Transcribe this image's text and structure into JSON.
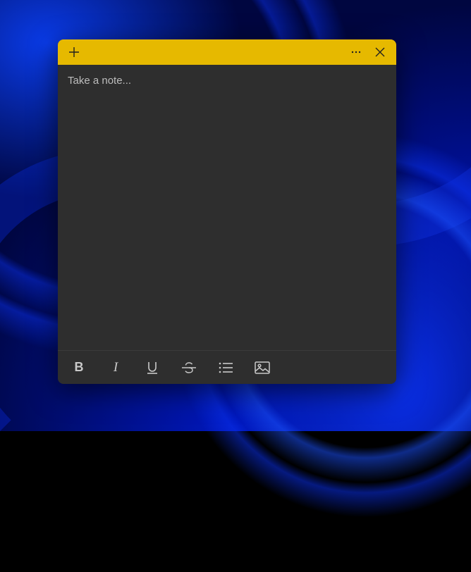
{
  "colors": {
    "titlebar": "#e6b900",
    "window_bg": "#2e2e2e",
    "placeholder": "#bdbdbd",
    "icon": "#c9c9c9"
  },
  "note": {
    "placeholder": "Take a note...",
    "content": ""
  },
  "titlebar": {
    "add_icon": "plus-icon",
    "more_icon": "more-horizontal-icon",
    "close_icon": "close-icon"
  },
  "format_bar": {
    "bold": "B",
    "italic": "I",
    "underline": "U",
    "strike_icon": "strikethrough-icon",
    "list_icon": "bullet-list-icon",
    "image_icon": "picture-icon"
  }
}
